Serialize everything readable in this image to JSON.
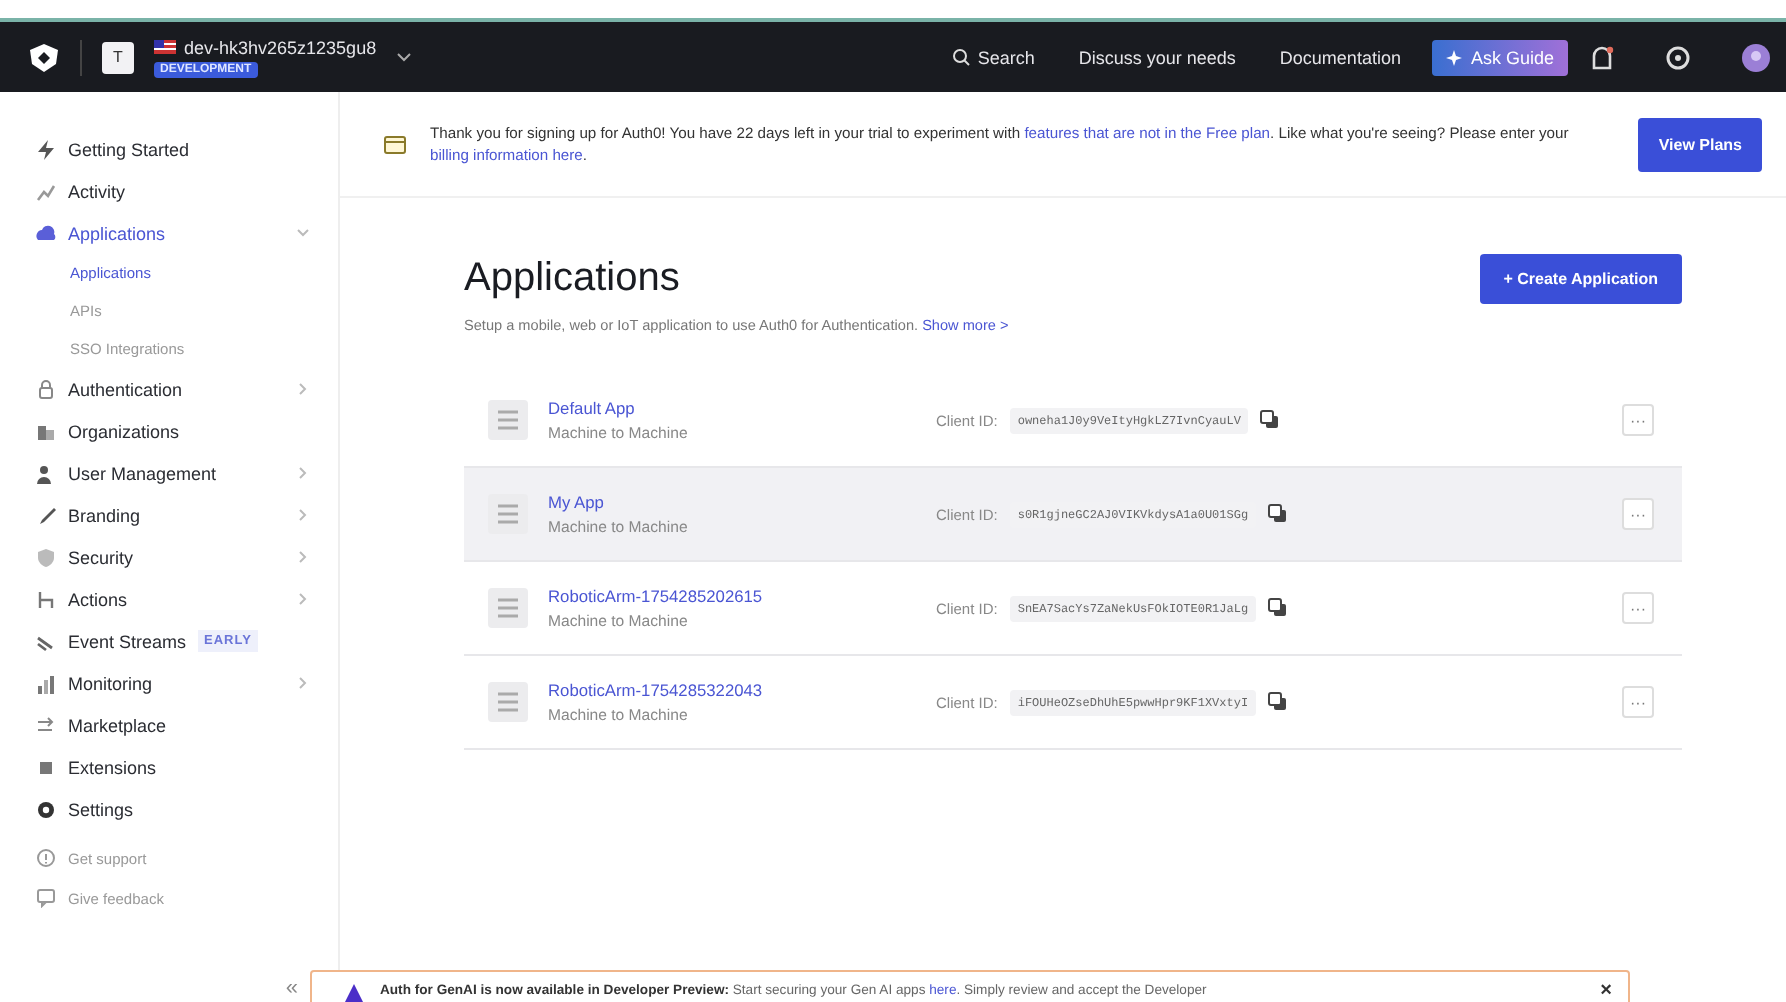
{
  "topbar": {
    "tenant_initial": "T",
    "tenant_name": "dev-hk3hv265z1235gu8",
    "environment": "DEVELOPMENT",
    "links": [
      {
        "label": "Search",
        "kind": "search"
      },
      {
        "label": "Discuss your needs",
        "kind": "link"
      },
      {
        "label": "Documentation",
        "kind": "link"
      }
    ],
    "guide_button": "Ask Guide"
  },
  "sidebar": {
    "items": [
      {
        "label": "Getting Started",
        "kind": "link",
        "selected": false
      },
      {
        "label": "Activity",
        "kind": "link",
        "selected": false
      },
      {
        "label": "Applications",
        "kind": "group",
        "expanded": true,
        "selected": true,
        "children": [
          {
            "label": "Applications",
            "selected": true
          },
          {
            "label": "APIs",
            "selected": false
          },
          {
            "label": "SSO Integrations",
            "selected": false
          }
        ]
      },
      {
        "label": "Authentication",
        "kind": "group",
        "expanded": false,
        "selected": false
      },
      {
        "label": "Organizations",
        "kind": "link",
        "selected": false
      },
      {
        "label": "User Management",
        "kind": "group",
        "expanded": false,
        "selected": false
      },
      {
        "label": "Branding",
        "kind": "group",
        "expanded": false,
        "selected": false
      },
      {
        "label": "Security",
        "kind": "group",
        "expanded": false,
        "selected": false
      },
      {
        "label": "Actions",
        "kind": "group",
        "expanded": false,
        "selected": false
      },
      {
        "label": "Event Streams",
        "kind": "link",
        "selected": false,
        "badge": "EARLY"
      },
      {
        "label": "Monitoring",
        "kind": "group",
        "expanded": false,
        "selected": false
      },
      {
        "label": "Marketplace",
        "kind": "link",
        "selected": false
      },
      {
        "label": "Extensions",
        "kind": "link",
        "selected": false
      },
      {
        "label": "Settings",
        "kind": "link",
        "selected": false
      }
    ],
    "footer": [
      "Get support",
      "Give feedback"
    ],
    "collapse": "«"
  },
  "trial_banner": {
    "text": "Thank you for signing up for Auth0! You have 22 days left in your trial to experiment with ",
    "link1": "features that are not in the Free plan",
    "text2": ". Like what you're seeing? Please enter your ",
    "link2": "billing information here",
    "text3": ".",
    "button": "View Plans"
  },
  "page": {
    "title": "Applications",
    "description": "Setup a mobile, web or IoT application to use Auth0 for Authentication.",
    "show_more": "Show more >",
    "create_button": "+ Create Application"
  },
  "applications": [
    {
      "name": "Default App",
      "type": "Machine to Machine",
      "client_id_label": "Client ID:",
      "client_id": "owneha1J0y9VeItyHgkLZ7IvnCyauLV",
      "more": "···",
      "selected": false
    },
    {
      "name": "My App",
      "type": "Machine to Machine",
      "client_id_label": "Client ID:",
      "client_id": "s0R1gjneGC2AJ0VIKVkdysA1a0U01SGg",
      "more": "···",
      "selected": true
    },
    {
      "name": "RoboticArm-1754285202615",
      "type": "Machine to Machine",
      "client_id_label": "Client ID:",
      "client_id": "SnEA7SacYs7ZaNekUsFOkIOTE0R1JaLg",
      "more": "···",
      "selected": false
    },
    {
      "name": "RoboticArm-1754285322043",
      "type": "Machine to Machine",
      "client_id_label": "Client ID:",
      "client_id": "iFOUHeOZseDhUhE5pwwHpr9KF1XVxtyI",
      "more": "···",
      "selected": false
    }
  ],
  "toast": {
    "lead": "Auth for GenAI is now available in Developer Preview:",
    "text": " Start securing your Gen AI apps ",
    "link": "here",
    "text2": ". Simply review and accept the Developer",
    "close": "×"
  }
}
